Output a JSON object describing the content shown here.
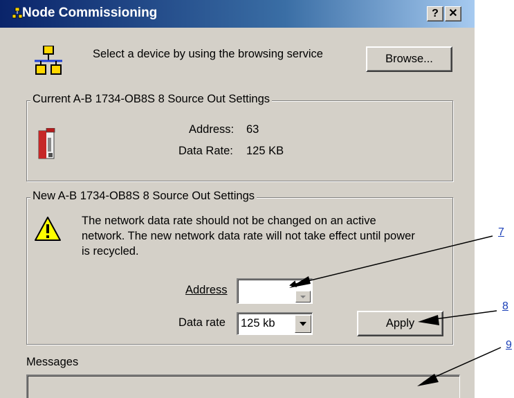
{
  "window": {
    "title": "Node Commissioning",
    "help_label": "?",
    "close_label": "✕"
  },
  "browse": {
    "prompt": "Select a device by using the browsing service",
    "button_label": "Browse..."
  },
  "current": {
    "group_label": "Current A-B 1734-OB8S 8 Source Out Settings",
    "address_label": "Address:",
    "address_value": "63",
    "rate_label": "Data Rate:",
    "rate_value": "125 KB"
  },
  "new": {
    "group_label": "New A-B 1734-OB8S 8 Source Out Settings",
    "warning_line1": "The network data rate should not be changed on an active",
    "warning_line2": "network. The new network data rate will not take effect until power",
    "warning_line3": "is recycled.",
    "address_label": "Address",
    "address_value": "",
    "rate_label": "Data rate",
    "rate_value": "125 kb",
    "apply_label": "Apply"
  },
  "messages": {
    "label": "Messages"
  },
  "callouts": [
    "7",
    "8",
    "9"
  ],
  "icons": {
    "title": "node-icon",
    "network": "network-icon",
    "device": "module-icon",
    "warning": "warning-icon"
  },
  "colors": {
    "title_bar_start": "#0a246a",
    "title_bar_end": "#a6caf0",
    "face": "#d4d0c8",
    "callout": "#1a3fb8"
  }
}
